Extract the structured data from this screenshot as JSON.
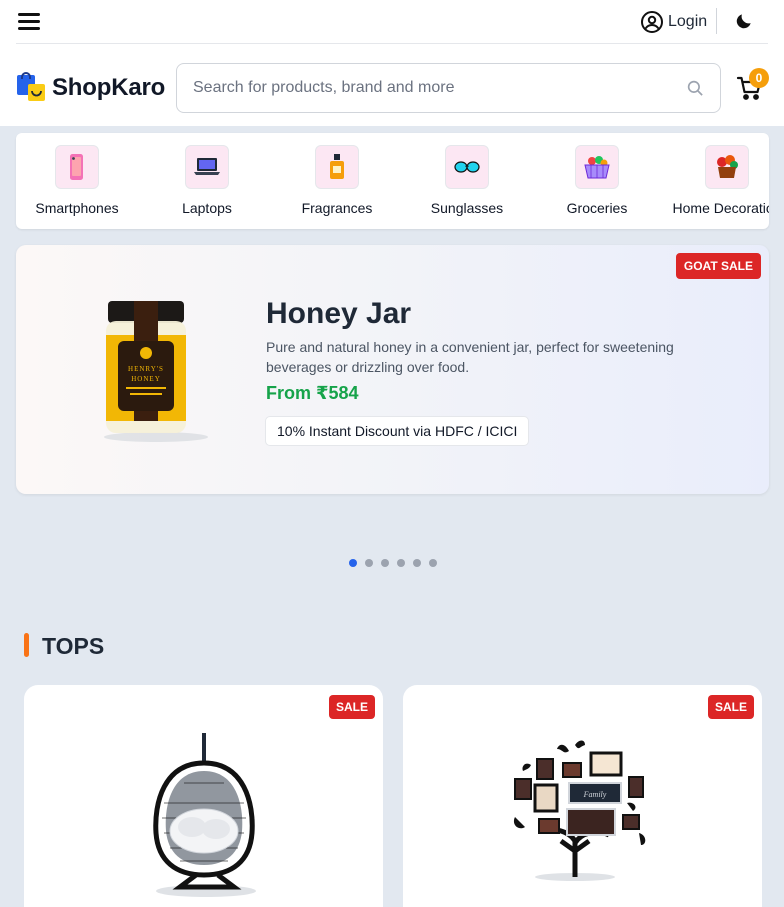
{
  "header": {
    "login_label": "Login",
    "brand": "ShopKaro",
    "search_placeholder": "Search for products, brand and more",
    "cart_count": "0",
    "accent": "#f59e0b"
  },
  "categories": [
    {
      "label": "Smartphones",
      "icon": "smartphone-icon"
    },
    {
      "label": "Laptops",
      "icon": "laptop-icon"
    },
    {
      "label": "Fragrances",
      "icon": "perfume-icon"
    },
    {
      "label": "Sunglasses",
      "icon": "sunglasses-icon"
    },
    {
      "label": "Groceries",
      "icon": "grocery-basket-icon"
    },
    {
      "label": "Home Decoration",
      "icon": "home-decor-icon"
    }
  ],
  "banner": {
    "badge": "GOAT SALE",
    "title": "Honey Jar",
    "description": "Pure and natural honey in a convenient jar, perfect for sweetening beverages or drizzling over food.",
    "price": "From ₹584",
    "offer": "10% Instant Discount via HDFC / ICICI",
    "image_label_brand": "HENRY'S",
    "image_label_product": "HONEY",
    "carousel": {
      "total": 6,
      "active": 0
    }
  },
  "section": {
    "title": "TOPS"
  },
  "products": [
    {
      "badge": "SALE",
      "image": "hanging-egg-chair"
    },
    {
      "badge": "SALE",
      "image": "family-tree-photo-frame"
    }
  ],
  "colors": {
    "sale_red": "#dc2626",
    "price_green": "#16a34a",
    "carousel_active": "#2563eb",
    "section_accent": "#f97316"
  }
}
